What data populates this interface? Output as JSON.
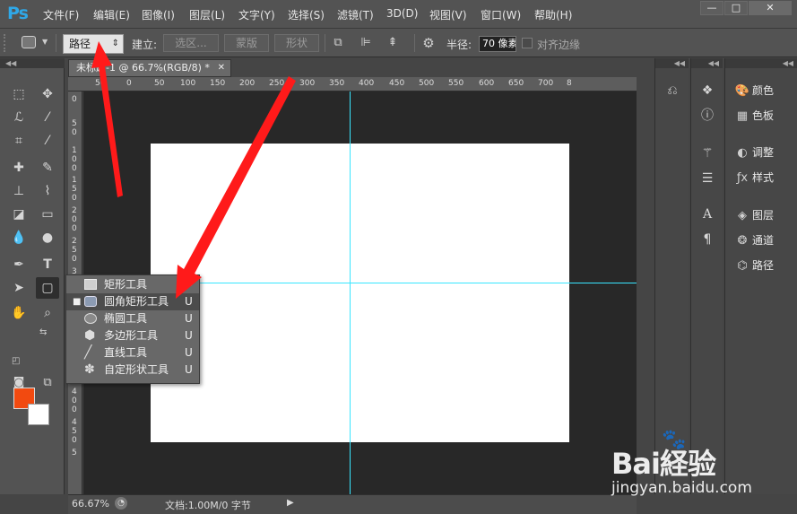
{
  "app": {
    "logo": "Ps"
  },
  "menu": [
    "文件(F)",
    "编辑(E)",
    "图像(I)",
    "图层(L)",
    "文字(Y)",
    "选择(S)",
    "滤镜(T)",
    "3D(D)",
    "视图(V)",
    "窗口(W)",
    "帮助(H)"
  ],
  "window_controls": {
    "minimize": "—",
    "maximize": "□",
    "close": "✕"
  },
  "options": {
    "mode_value": "路径",
    "make_label": "建立:",
    "selection_btn": "选区...",
    "mask_btn": "蒙版",
    "shape_btn": "形状",
    "radius_label": "半径:",
    "radius_value": "70 像素",
    "align_edges_label": "对齐边缘"
  },
  "document": {
    "tab_title": "未标题-1 @ 66.7%(RGB/8) *",
    "tab_close": "✕",
    "ruler_top": [
      "50",
      "0",
      "50",
      "100",
      "150",
      "200",
      "250",
      "300",
      "350",
      "400",
      "450",
      "500",
      "550",
      "600",
      "650",
      "700",
      "8"
    ],
    "ruler_left": [
      "0",
      "5",
      "0",
      "1",
      "0",
      "0",
      "1",
      "5",
      "0",
      "2",
      "0",
      "0",
      "2",
      "5",
      "0",
      "3",
      "0",
      "0",
      "3",
      "5",
      "0",
      "4",
      "0",
      "0",
      "4",
      "5",
      "0",
      "5"
    ]
  },
  "flyout": {
    "items": [
      {
        "label": "矩形工具",
        "key": "U",
        "icon": "rectangle-icon",
        "selected": false
      },
      {
        "label": "圆角矩形工具",
        "key": "U",
        "icon": "rounded-rectangle-icon",
        "selected": true
      },
      {
        "label": "椭圆工具",
        "key": "U",
        "icon": "ellipse-icon",
        "selected": false
      },
      {
        "label": "多边形工具",
        "key": "U",
        "icon": "polygon-icon",
        "selected": false
      },
      {
        "label": "直线工具",
        "key": "U",
        "icon": "line-icon",
        "selected": false
      },
      {
        "label": "自定形状工具",
        "key": "U",
        "icon": "custom-shape-icon",
        "selected": false
      }
    ],
    "selected_marker": "■"
  },
  "status": {
    "zoom": "66.67%",
    "doc_info": "文档:1.00M/0 字节"
  },
  "panels": [
    {
      "label": "颜色",
      "icon": "color-icon"
    },
    {
      "label": "色板",
      "icon": "swatches-icon"
    },
    {
      "label": "调整",
      "icon": "adjustments-icon"
    },
    {
      "label": "样式",
      "icon": "styles-icon"
    },
    {
      "label": "图层",
      "icon": "layers-icon"
    },
    {
      "label": "通道",
      "icon": "channels-icon"
    },
    {
      "label": "路径",
      "icon": "paths-icon"
    }
  ],
  "colors": {
    "foreground": "#f24a10",
    "background": "#ffffff",
    "guide": "#39e6ff",
    "arrow": "#ff1a1a"
  },
  "watermark": {
    "brand": "Bai経验",
    "site": "jingyan.baidu.com"
  }
}
